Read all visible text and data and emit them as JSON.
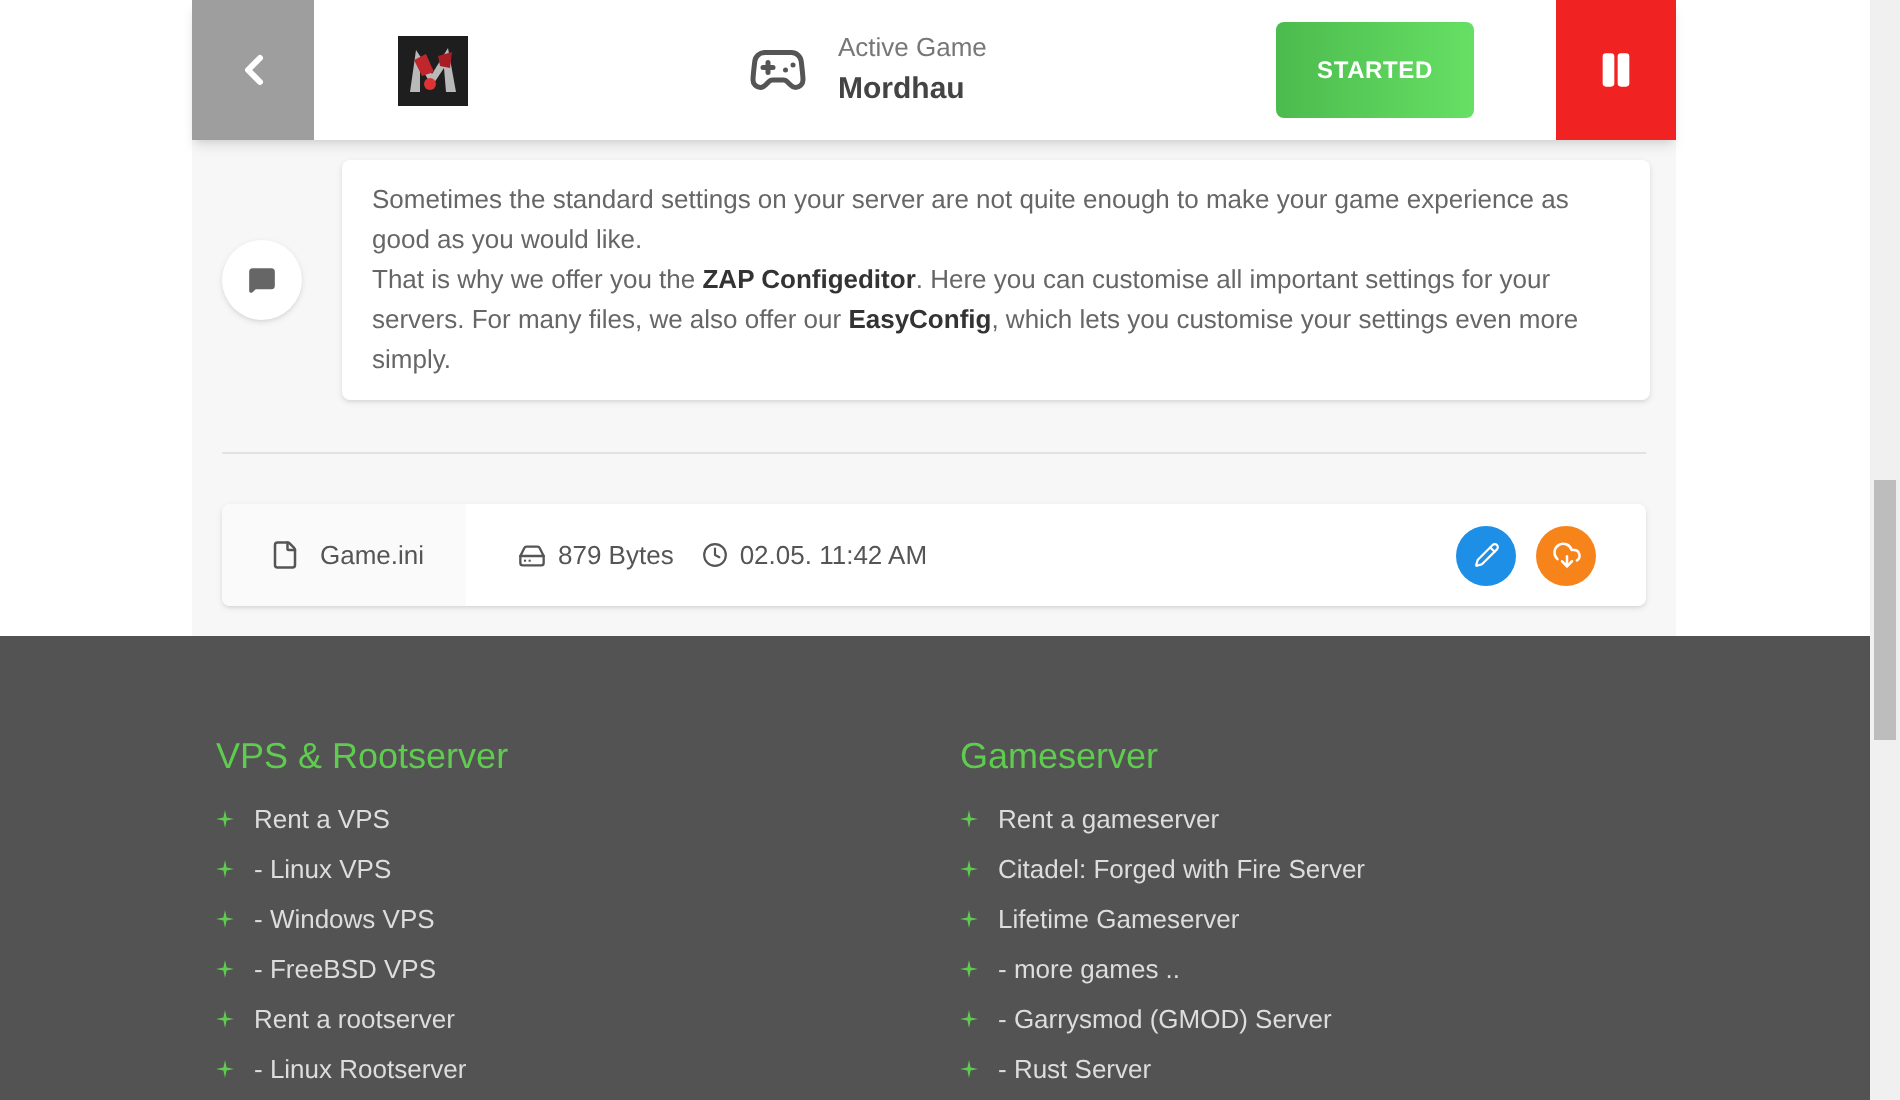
{
  "header": {
    "active_label": "Active Game",
    "game": "Mordhau",
    "status_button": "STARTED"
  },
  "info": {
    "paragraphs": [
      "Sometimes the standard settings on your server are not quite enough to make your game experience as good as you would like.",
      "That is why we offer you the **ZAP Configeditor**. Here you can customise all important settings for your servers. For many files, we also offer our **EasyConfig**, which lets you customise your settings even more simply."
    ]
  },
  "file": {
    "name": "Game.ini",
    "size": "879 Bytes",
    "modified": "02.05. 11:42 AM"
  },
  "footer": {
    "columns": [
      {
        "title": "VPS & Rootserver",
        "links": [
          "Rent a VPS",
          "- Linux VPS",
          "- Windows VPS",
          "- FreeBSD VPS",
          "Rent a rootserver",
          "- Linux Rootserver"
        ]
      },
      {
        "title": "Gameserver",
        "links": [
          "Rent a gameserver",
          "Citadel: Forged with Fire Server",
          "Lifetime Gameserver",
          "- more games ..",
          "- Garrysmod (GMOD) Server",
          "- Rust Server"
        ]
      }
    ]
  }
}
